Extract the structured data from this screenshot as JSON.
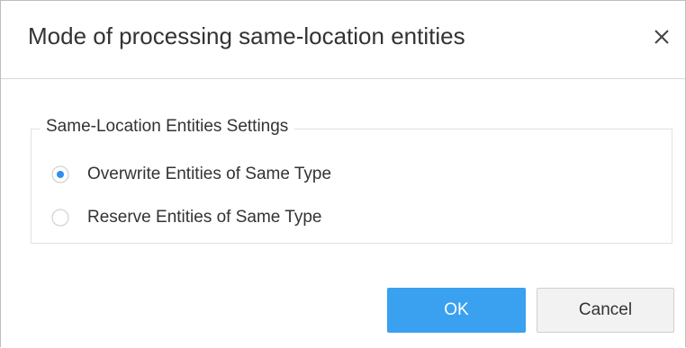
{
  "dialog": {
    "title": "Mode of processing same-location entities",
    "close_icon": "close-icon"
  },
  "settings_group": {
    "legend": "Same-Location Entities Settings",
    "options": [
      {
        "label": "Overwrite Entities of Same Type",
        "selected": true
      },
      {
        "label": "Reserve Entities of Same Type",
        "selected": false
      }
    ]
  },
  "buttons": {
    "ok_label": "OK",
    "cancel_label": "Cancel"
  },
  "colors": {
    "accent": "#3aa0f0",
    "radio_dot": "#2f8ff0"
  }
}
